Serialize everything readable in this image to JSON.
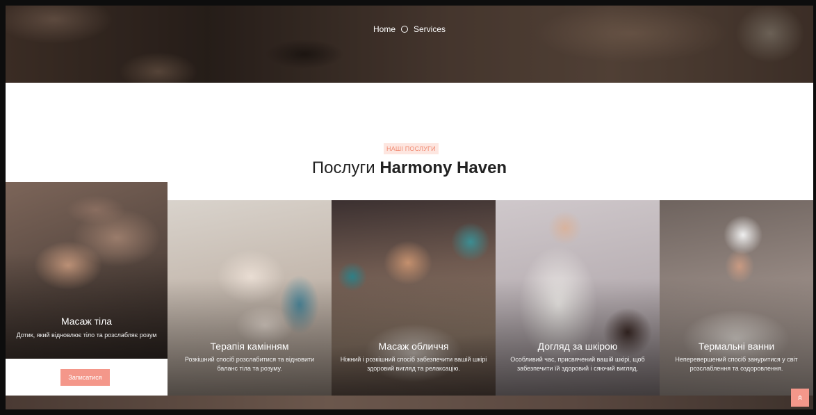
{
  "breadcrumb": {
    "home": "Home",
    "current": "Services"
  },
  "section": {
    "badge": "НАШІ ПОСЛУГИ",
    "title_prefix": "Послуги",
    "title_brand": "Harmony Haven"
  },
  "services": [
    {
      "title": "Масаж тіла",
      "description": "Дотик, який відновлює тіло та розслабляє розум",
      "button": "Записатися"
    },
    {
      "title": "Терапія камінням",
      "description": "Розкішний спосіб розслабитися та відновити баланс тіла та розуму."
    },
    {
      "title": "Масаж обличчя",
      "description": "Ніжний і розкішний спосіб забезпечити вашій шкірі здоровий вигляд та релаксацію."
    },
    {
      "title": "Догляд за шкірою",
      "description": "Особливий час, присвячений вашій шкірі, щоб забезпечити їй здоровий і сяючий вигляд."
    },
    {
      "title": "Термальні ванни",
      "description": "Неперевершений спосіб зануритися у світ розслаблення та оздоровлення."
    }
  ],
  "scroll_top": {
    "icon": "double-chevron-up-icon",
    "glyph": "»",
    "color": "#f4978a"
  },
  "colors": {
    "accent": "#f4978a",
    "badge_bg": "#fde6e0",
    "badge_text": "#f08a72"
  }
}
